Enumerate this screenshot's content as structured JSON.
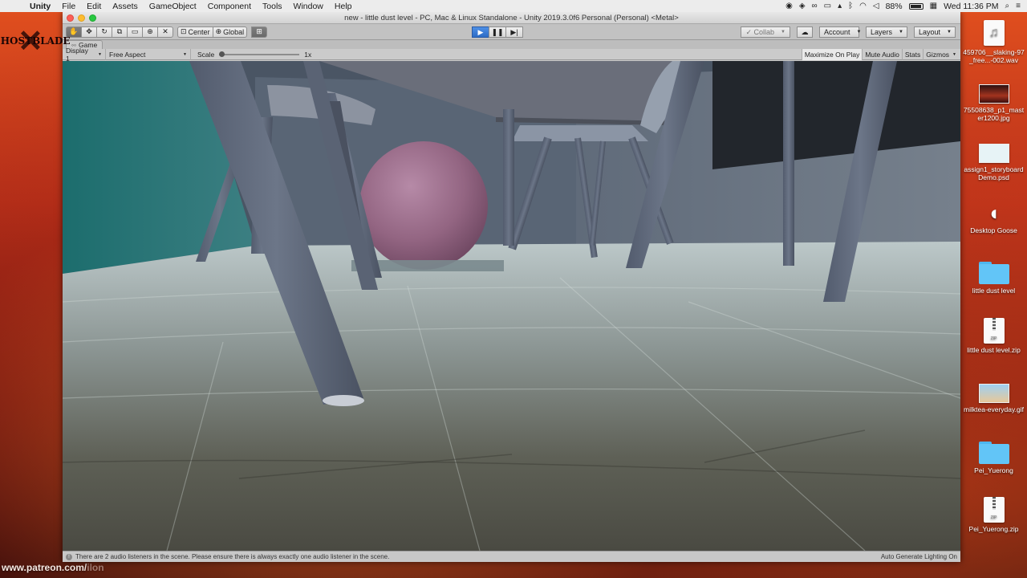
{
  "menubar": {
    "app": "Unity",
    "items": [
      "File",
      "Edit",
      "Assets",
      "GameObject",
      "Component",
      "Tools",
      "Window",
      "Help"
    ],
    "battery": "88%",
    "clock": "Wed 11:36 PM"
  },
  "wallpaper": {
    "logo_text": "GHOSTBLADE",
    "url_text": "www.patreon.com/",
    "url_faded": "ilon"
  },
  "window": {
    "title": "new - little dust level - PC, Mac & Linux Standalone - Unity 2019.3.0f6 Personal (Personal) <Metal>"
  },
  "toolbar": {
    "pivot_label": "Center",
    "space_label": "Global",
    "collab_label": "Collab",
    "account_label": "Account",
    "layers_label": "Layers",
    "layout_label": "Layout"
  },
  "game_view": {
    "tab_label": "Game",
    "display_label": "Display 1",
    "aspect_label": "Free Aspect",
    "scale_label": "Scale",
    "scale_value": "1x",
    "maximize_label": "Maximize On Play",
    "mute_label": "Mute Audio",
    "stats_label": "Stats",
    "gizmos_label": "Gizmos"
  },
  "status": {
    "message": "There are 2 audio listeners in the scene. Please ensure there is always exactly one audio listener in the scene.",
    "lighting": "Auto Generate Lighting On"
  },
  "desktop_icons": [
    {
      "label": "459706__slaking-97_free...-002.wav",
      "kind": "audio"
    },
    {
      "label": "75508638_p1_master1200.jpg",
      "kind": "image"
    },
    {
      "label": "assign1_storyboardDemo.psd",
      "kind": "image"
    },
    {
      "label": "Desktop Goose",
      "kind": "app"
    },
    {
      "label": "little dust level",
      "kind": "folder"
    },
    {
      "label": "little dust level.zip",
      "kind": "zip"
    },
    {
      "label": "milktea-everyday.gif",
      "kind": "image"
    },
    {
      "label": "Pei_Yuerong",
      "kind": "folder"
    },
    {
      "label": "Pei_Yuerong.zip",
      "kind": "zip"
    }
  ],
  "colors": {
    "play_active": "#2d6cc5",
    "wallpaper": "#c03a1c",
    "folder": "#62c5f7"
  }
}
